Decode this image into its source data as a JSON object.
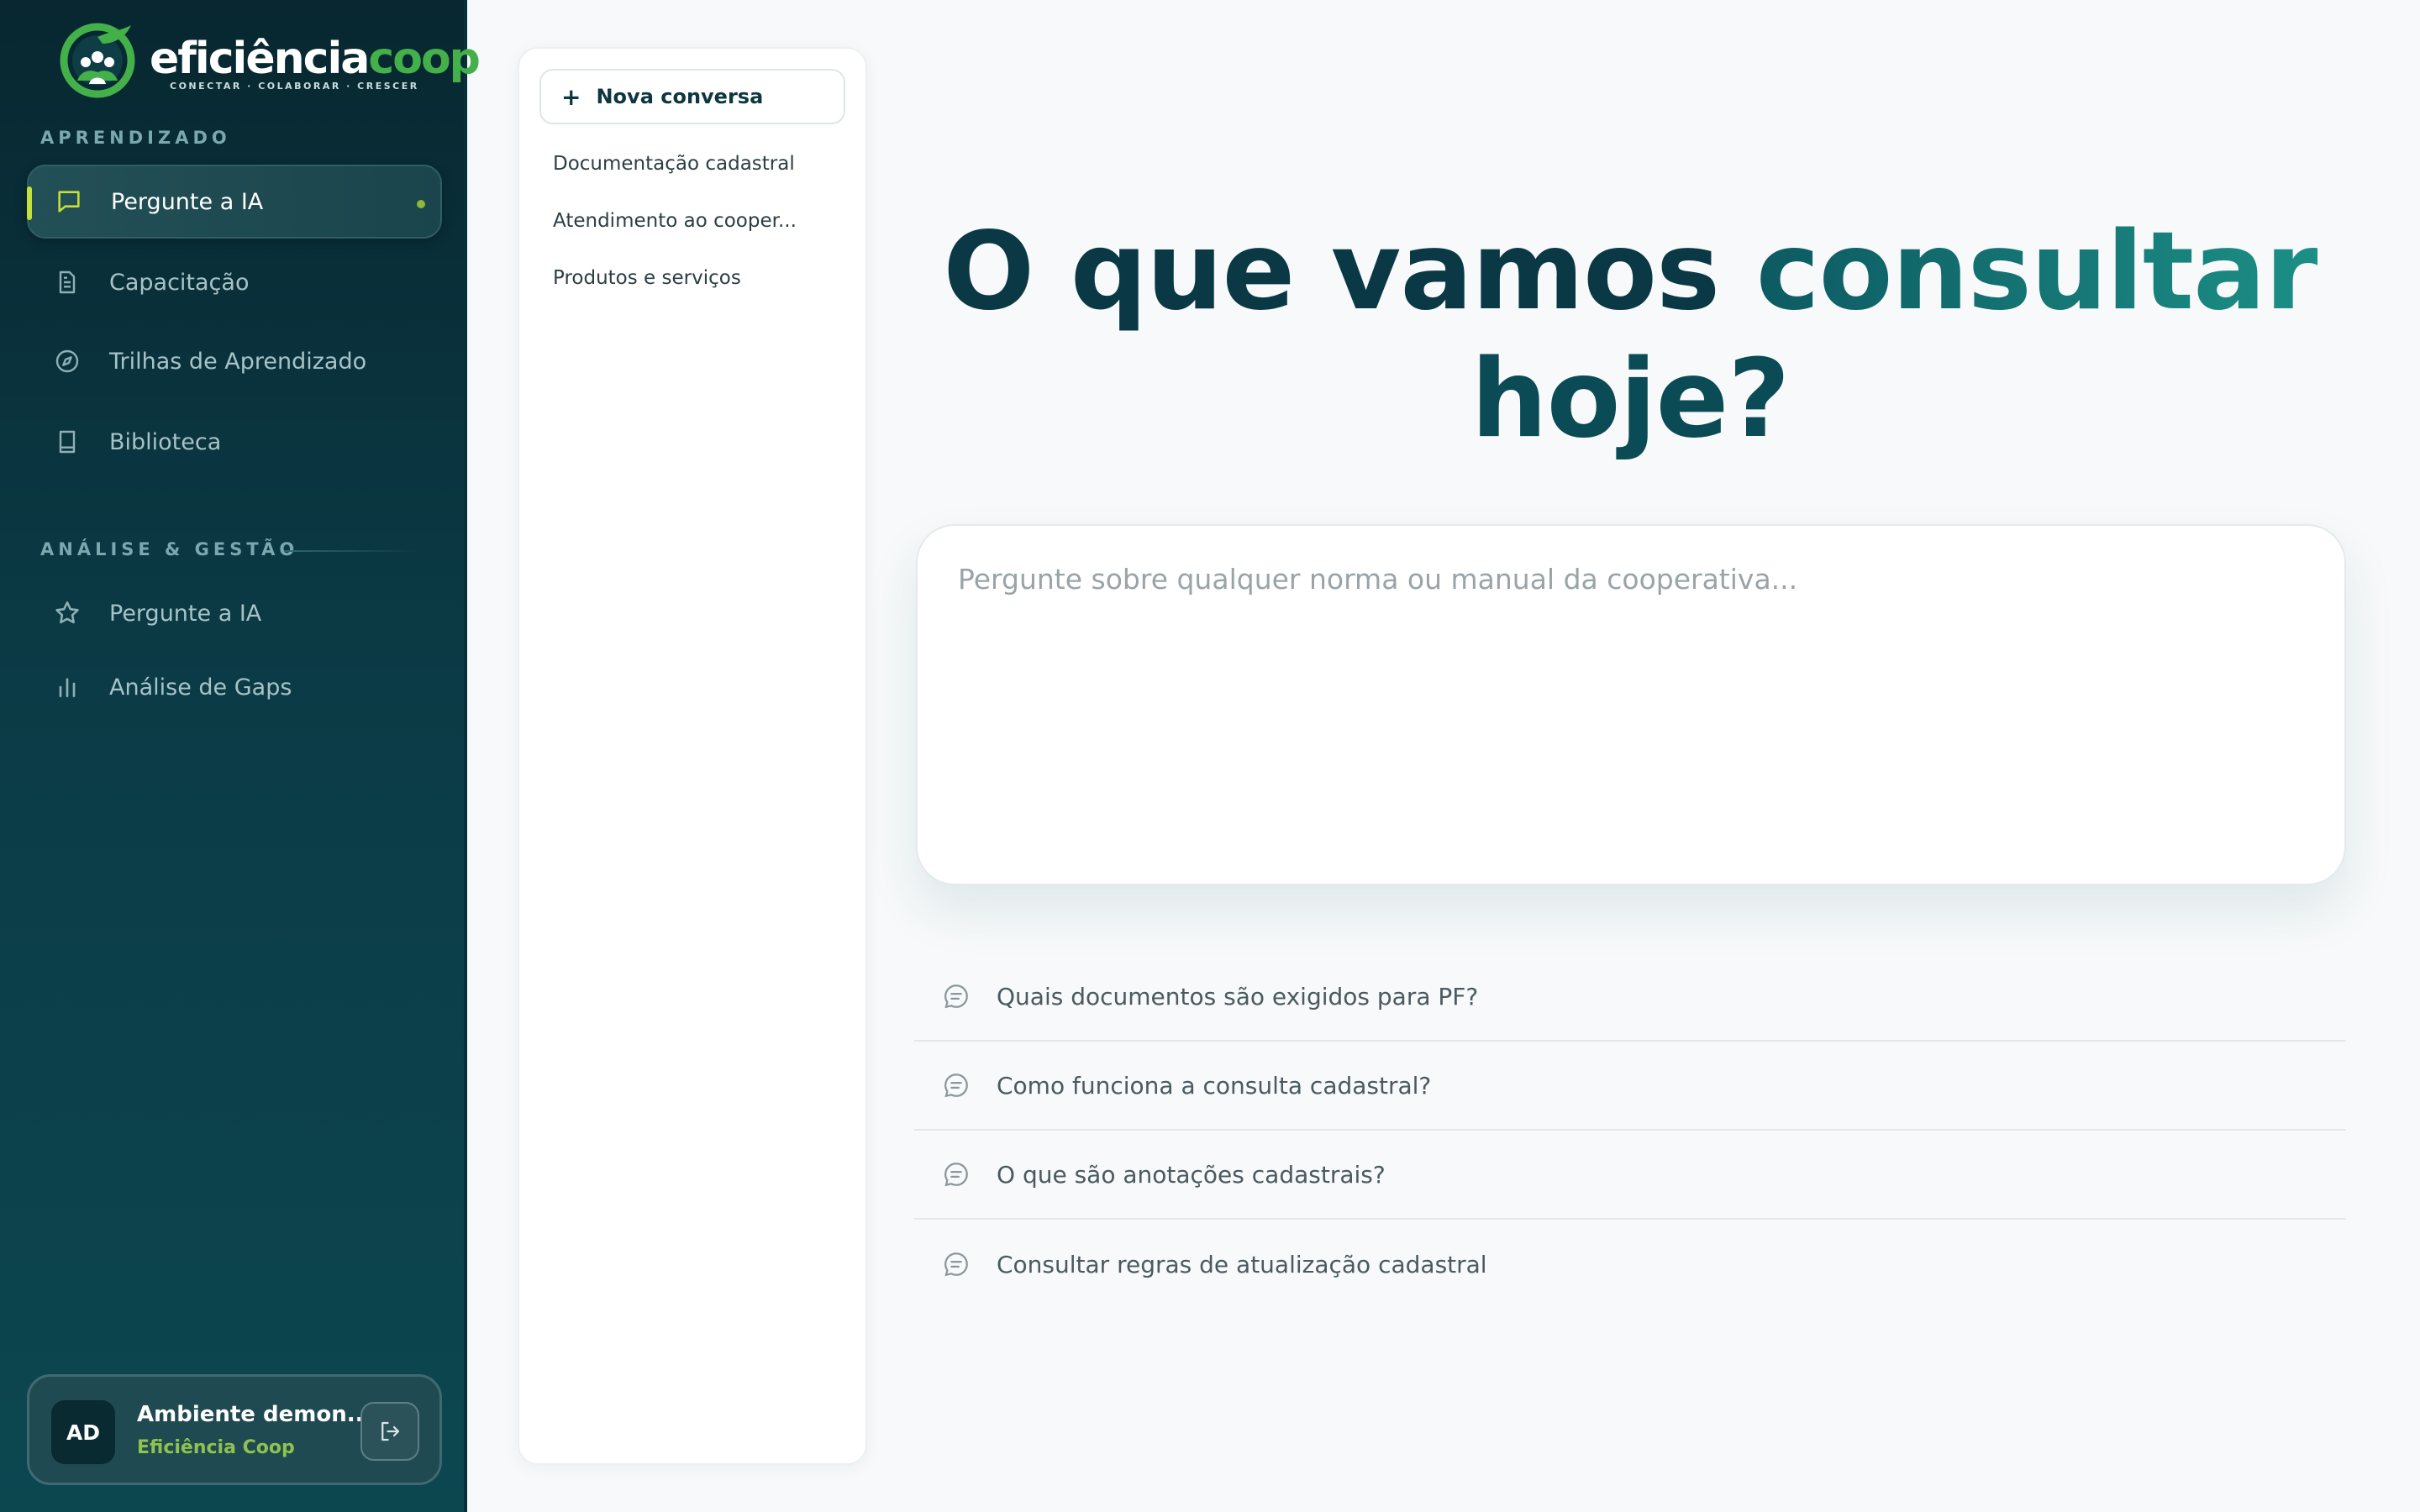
{
  "brand": {
    "name_part1": "eficiência",
    "name_part2": "coop",
    "tagline": "CONECTAR · COLABORAR · CRESCER",
    "colors": {
      "primary_dark": "#0a3945",
      "accent_green": "#43b049",
      "accent_lime": "#c6e03a",
      "teal": "#1c8f86"
    }
  },
  "sidebar": {
    "section1_label": "APRENDIZADO",
    "section1_items": [
      {
        "label": "Pergunte a IA",
        "icon": "chat-bubble-icon",
        "active": true
      },
      {
        "label": "Capacitação",
        "icon": "document-icon"
      },
      {
        "label": "Trilhas de Aprendizado",
        "icon": "compass-icon"
      },
      {
        "label": "Biblioteca",
        "icon": "book-icon"
      }
    ],
    "section2_label": "ANÁLISE & GESTÃO",
    "section2_items": [
      {
        "label": "Pergunte a IA",
        "icon": "star-icon"
      },
      {
        "label": "Análise de Gaps",
        "icon": "bar-chart-icon"
      }
    ],
    "user": {
      "initials": "AD",
      "name": "Ambiente demon...",
      "org": "Eficiência Coop"
    }
  },
  "conversations": {
    "new_button": "Nova conversa",
    "items": [
      "Documentação cadastral",
      "Atendimento ao cooper...",
      "Produtos e serviços"
    ]
  },
  "main": {
    "headline_part1": "O que vamos ",
    "headline_accent": "consultar",
    "headline_part2": "hoje?",
    "input_placeholder": "Pergunte sobre qualquer norma ou manual da cooperativa...",
    "suggestions": [
      "Quais documentos são exigidos para PF?",
      "Como funciona a consulta cadastral?",
      "O que são anotações cadastrais?",
      "Consultar regras de atualização cadastral"
    ]
  }
}
